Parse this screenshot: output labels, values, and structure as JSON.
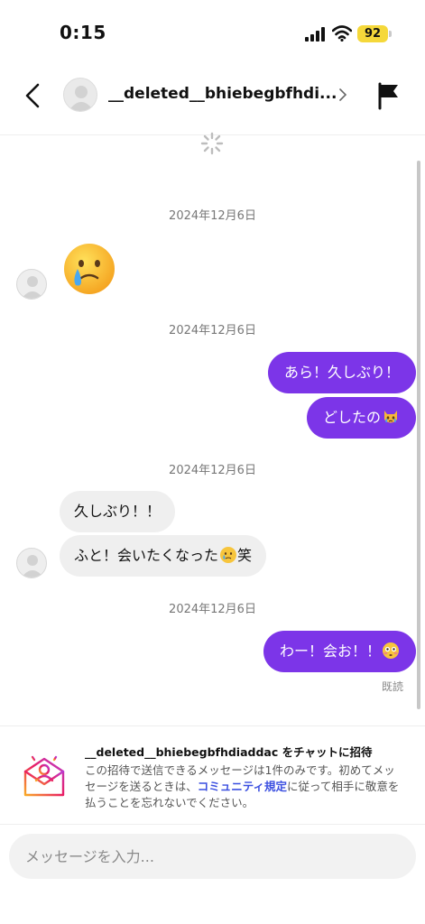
{
  "status_bar": {
    "time": "0:15",
    "battery": "92"
  },
  "header": {
    "contact_name": "__deleted__bhiebegbfhdi..."
  },
  "messages": {
    "date_1": "2024年12月6日",
    "date_2": "2024年12月6日",
    "out_1": "あら！久しぶり！",
    "out_2": "どしたの",
    "date_3": "2024年12月6日",
    "in_1": "久しぶり！！",
    "in_2a": "ふと！会いたくなった",
    "in_2b": "笑",
    "date_4": "2024年12月6日",
    "out_3": "わー！会お！！",
    "read_receipt": "既読"
  },
  "invite": {
    "title": "__deleted__bhiebegbfhdiaddac をチャットに招待",
    "body_pre": "この招待で送信できるメッセージは1件のみです。初めてメッセージを送るときは、",
    "link": "コミュニティ規定",
    "body_post": "に従って相手に敬意を払うことを忘れないでください。"
  },
  "composer": {
    "placeholder": "メッセージを入力..."
  },
  "colors": {
    "accent": "#7c35e8",
    "link": "#3b4fe0",
    "battery": "#f5d83a"
  }
}
